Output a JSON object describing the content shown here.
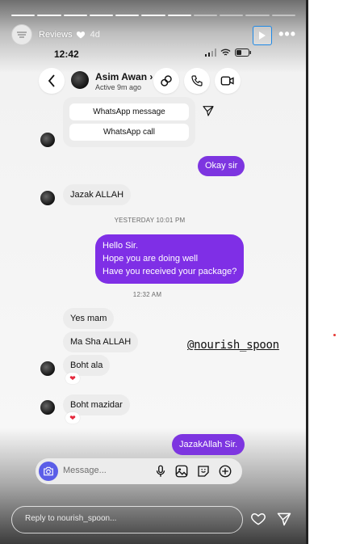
{
  "story": {
    "username": "Reviews",
    "time_ago": "4d",
    "progress_segments": 11,
    "active_segment": 7
  },
  "phone": {
    "clock": "12:42"
  },
  "contact": {
    "name": "Asim Awan",
    "chevron": "›",
    "status": "Active 9m ago"
  },
  "whatsapp": {
    "message_label": "WhatsApp message",
    "call_label": "WhatsApp call"
  },
  "messages": {
    "out1": "Okay sir",
    "in1": "Jazak ALLAH",
    "ts1": "YESTERDAY 10:01 PM",
    "out2_lines": [
      "Hello Sir.",
      "Hope you are doing well",
      "Have you received your package?"
    ],
    "ts2": "12:32 AM",
    "in2": "Yes mam",
    "in3": "Ma Sha ALLAH",
    "in4": "Boht ala",
    "in5": "Boht mazidar",
    "out3": "JazakAllah Sir.",
    "reaction": "❤"
  },
  "mention": "@nourish_spoon",
  "composer": {
    "placeholder": "Message..."
  },
  "reply": {
    "placeholder": "Reply to nourish_spoon..."
  },
  "colors": {
    "outgoing_bubble": "#7d35e0",
    "camera_button": "#5b5ee8",
    "play_border": "#1e88e5"
  }
}
